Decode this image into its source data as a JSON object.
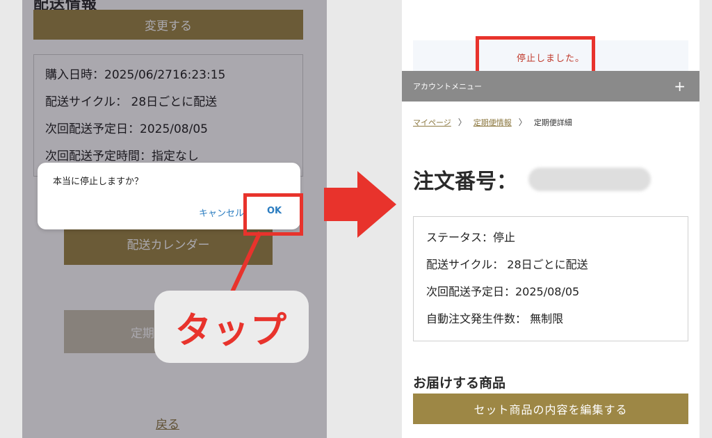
{
  "left": {
    "section_title": "配送情報",
    "change_button": "変更する",
    "info": [
      "購入日時：2025/06/2716:23:15",
      "配送サイクル：  28日ごとに配送",
      "次回配送予定日：2025/08/05",
      "次回配送予定時間：指定なし"
    ],
    "calendar_button": "配送カレンダー",
    "stop_button": "定期便",
    "back_link": "戻る"
  },
  "dialog": {
    "message": "本当に停止しますか？",
    "cancel": "キャンセル",
    "ok": "OK"
  },
  "tap_label": "タップ",
  "right": {
    "notice": "停止しました。",
    "account_menu": "アカウントメニュー",
    "account_toggle": "+",
    "breadcrumb": {
      "mypage": "マイページ",
      "subscription": "定期便情報",
      "current": "定期便詳細",
      "separator": "〉"
    },
    "order_label": "注文番号：",
    "status": [
      "ステータス：停止",
      "配送サイクル：  28日ごとに配送",
      "次回配送予定日：2025/08/05",
      "自動注文発生件数：  無制限"
    ],
    "deliver_title": "お届けする商品",
    "edit_button": "セット商品の内容を編集する"
  },
  "colors": {
    "gold": "#9d8745",
    "annotation_red": "#e8332c",
    "link_blue": "#2a7cc0"
  }
}
